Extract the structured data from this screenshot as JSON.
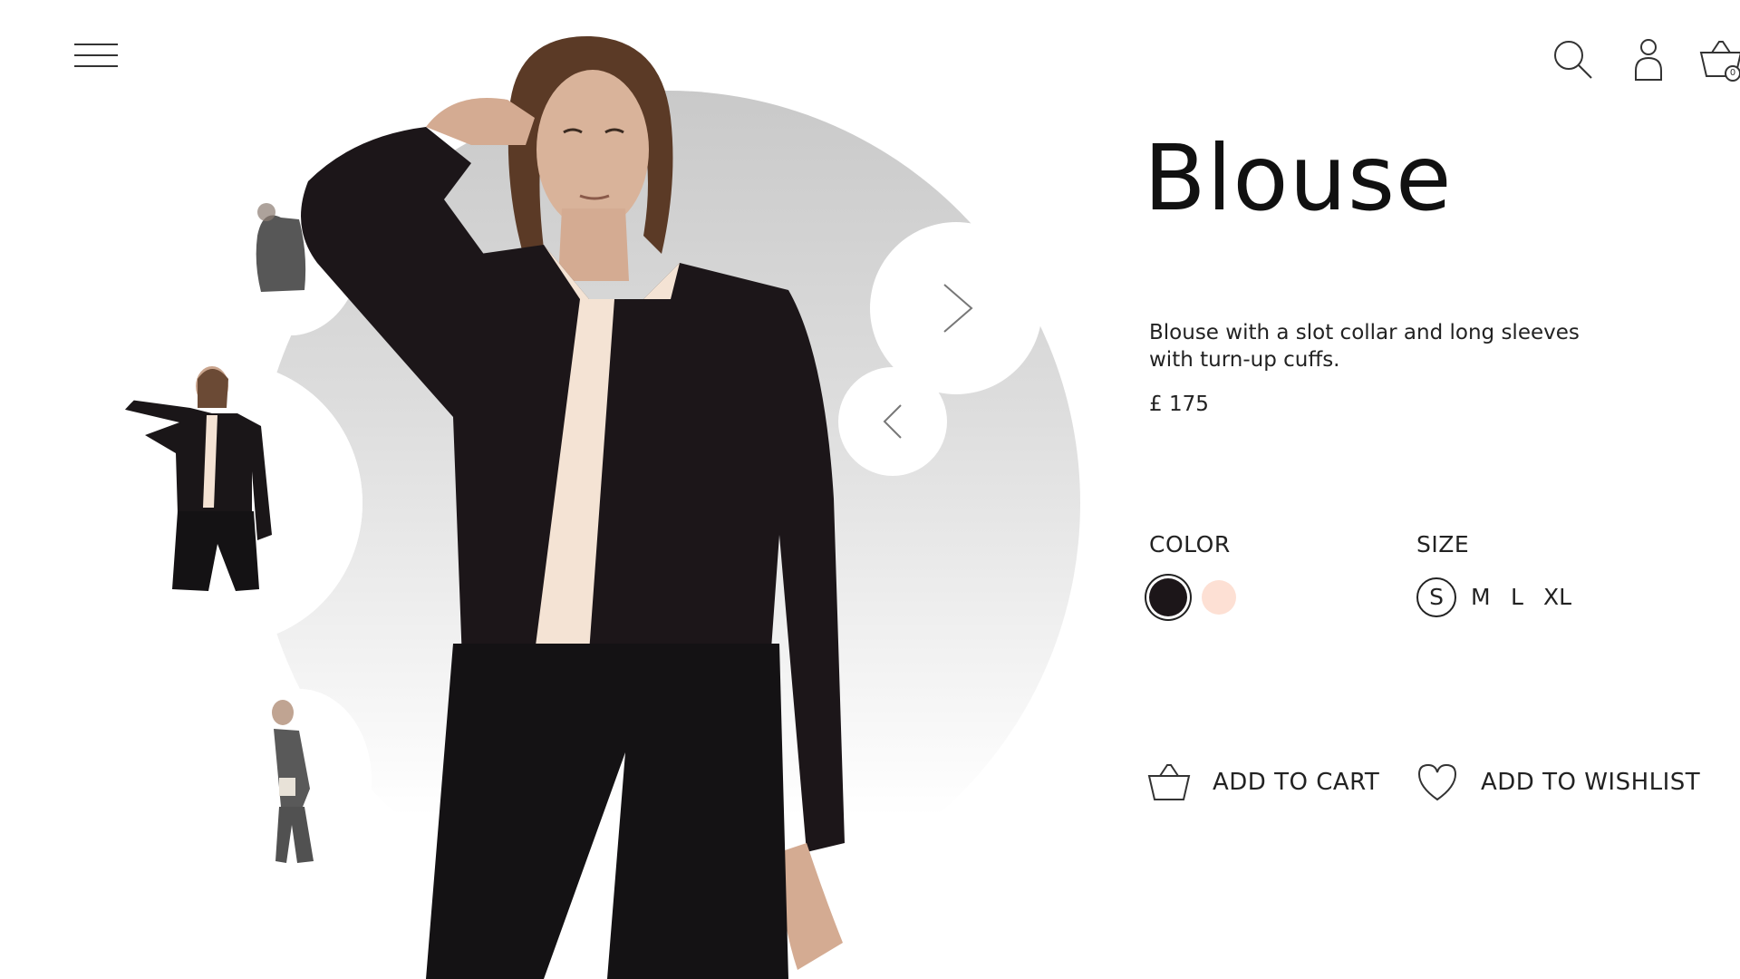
{
  "header": {
    "menu_icon": "hamburger-menu-icon",
    "search_icon": "search-icon",
    "account_icon": "user-icon",
    "cart_icon": "basket-icon",
    "cart_count": "0"
  },
  "gallery": {
    "thumbnails": [
      "thumbnail-1",
      "thumbnail-2",
      "thumbnail-3"
    ],
    "next_icon": "chevron-right-icon",
    "prev_icon": "chevron-left-icon"
  },
  "product": {
    "title": "Blouse",
    "description": "Blouse with a slot collar and long sleeves with turn-up cuffs.",
    "price": "£ 175",
    "color_label": "COLOR",
    "colors": [
      {
        "name": "black",
        "hex": "#1c1619",
        "selected": true
      },
      {
        "name": "peach",
        "hex": "#fde0d4",
        "selected": false
      }
    ],
    "size_label": "SIZE",
    "sizes": [
      "S",
      "M",
      "L",
      "XL"
    ],
    "selected_size": "S",
    "add_to_cart": "ADD TO CART",
    "add_to_wishlist": "ADD TO WISHLIST"
  }
}
